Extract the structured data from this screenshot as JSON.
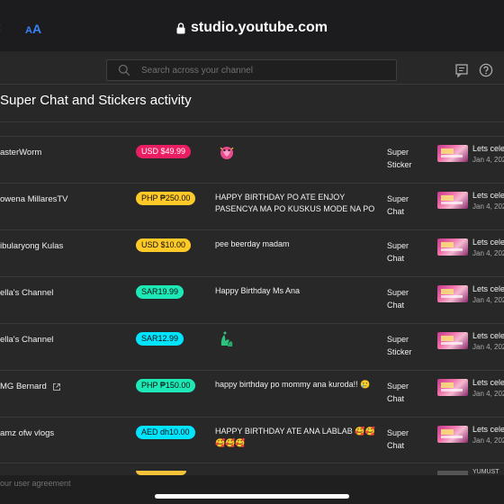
{
  "browser": {
    "aa_label": "AA",
    "url": "studio.youtube.com"
  },
  "header": {
    "search_placeholder": "Search across your channel"
  },
  "page": {
    "title": "Super Chat and Stickers activity"
  },
  "rows": [
    {
      "name": "asterWorm",
      "amount": "USD $49.99",
      "badge_color": "#e91e63",
      "badge_text_color": "#ffffff",
      "message": "",
      "sticker": "pink-heart-sticker",
      "type_line1": "Super",
      "type_line2": "Sticker",
      "video_title": "Lets celeb",
      "video_date": "Jan 4, 202"
    },
    {
      "name": "owena MillaresTV",
      "amount": "PHP ₱250.00",
      "badge_color": "#ffca28",
      "badge_text_color": "#0d0d0d",
      "message": "HAPPY BIRTHDAY PO ATE ENJOY PASENCYA MA PO KUSKUS MODE NA PO",
      "sticker": "",
      "type_line1": "Super",
      "type_line2": "Chat",
      "video_title": "Lets celeb",
      "video_date": "Jan 4, 202"
    },
    {
      "name": "ibularyong Kulas",
      "amount": "USD $10.00",
      "badge_color": "#ffca28",
      "badge_text_color": "#0d0d0d",
      "message": "pee beerday madam",
      "sticker": "",
      "type_line1": "Super",
      "type_line2": "Chat",
      "video_title": "Lets celeb",
      "video_date": "Jan 4, 202"
    },
    {
      "name": "ella's Channel",
      "amount": "SAR19.99",
      "badge_color": "#1de9b6",
      "badge_text_color": "#0d0d0d",
      "message": "Happy Birthday Ms Ana",
      "sticker": "",
      "type_line1": "Super",
      "type_line2": "Chat",
      "video_title": "Lets celeb",
      "video_date": "Jan 4, 202"
    },
    {
      "name": "ella's Channel",
      "amount": "SAR12.99",
      "badge_color": "#00e5ff",
      "badge_text_color": "#0d0d0d",
      "message": "",
      "sticker": "green-hands-sticker",
      "type_line1": "Super",
      "type_line2": "Sticker",
      "video_title": "Lets celeb",
      "video_date": "Jan 4, 202"
    },
    {
      "name": "MG Bernard",
      "amount": "PHP ₱150.00",
      "badge_color": "#1de9b6",
      "badge_text_color": "#0d0d0d",
      "message": "happy birthday po mommy ana kuroda!!",
      "emoji_after": "🥲",
      "sticker": "",
      "type_line1": "Super",
      "type_line2": "Chat",
      "video_title": "Lets celeb",
      "video_date": "Jan 4, 202",
      "external_link": true
    },
    {
      "name": "amz ofw vlogs",
      "amount": "AED dh10.00",
      "badge_color": "#00e5ff",
      "badge_text_color": "#0d0d0d",
      "message": "HAPPY BIRTHDAY ATE ANA LABLAB",
      "emoji_after": "🥰🥰 🥰🥰🥰",
      "sticker": "",
      "type_line1": "Super",
      "type_line2": "Chat",
      "video_title": "Lets celeb",
      "video_date": "Jan 4, 202"
    }
  ],
  "footer": {
    "agreement_text": "our user agreement",
    "peek_title": "YUMUST"
  }
}
